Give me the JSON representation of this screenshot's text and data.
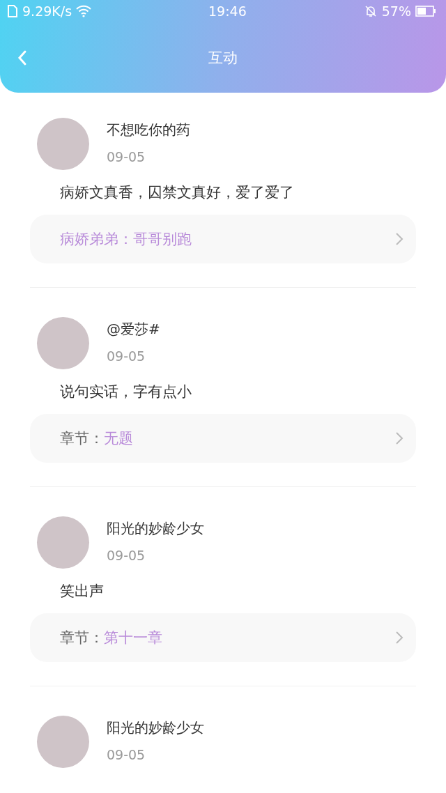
{
  "status_bar": {
    "speed": "9.29K/s",
    "time": "19:46",
    "battery": "57%"
  },
  "header": {
    "title": "互动"
  },
  "comments": [
    {
      "user": "不想吃你的药",
      "date": "09-05",
      "text": "病娇文真香，囚禁文真好，爱了爱了",
      "link": {
        "title": "病娇弟弟：哥哥别跑"
      }
    },
    {
      "user": "@爱莎#",
      "date": "09-05",
      "text": "说句实话，字有点小",
      "link": {
        "prefix": "章节：",
        "title": "无题"
      }
    },
    {
      "user": "阳光的妙龄少女",
      "date": "09-05",
      "text": "笑出声",
      "link": {
        "prefix": "章节：",
        "title": "第十一章"
      }
    },
    {
      "user": "阳光的妙龄少女",
      "date": "09-05"
    }
  ]
}
